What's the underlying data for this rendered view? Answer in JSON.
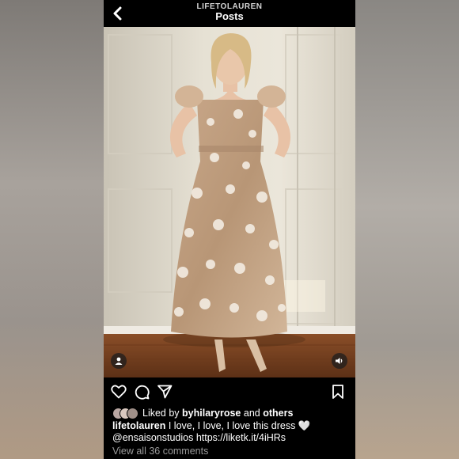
{
  "header": {
    "username": "LIFETOLAUREN",
    "title": "Posts"
  },
  "post": {
    "liked_prefix": "Liked by",
    "liked_user": "byhilaryrose",
    "liked_joiner": "and",
    "liked_others": "others",
    "caption_username": "lifetolauren",
    "caption_text": "I love, I love, I love this dress 🤍",
    "caption_mention": "@ensaisonstudios",
    "caption_link": "https://liketk.it/4iHRs",
    "view_comments": "View all 36 comments"
  },
  "icons": {
    "back": "chevron-left-icon",
    "tag": "person-tag-icon",
    "sound": "speaker-icon",
    "like": "heart-icon",
    "comment": "comment-icon",
    "share": "paper-plane-icon",
    "save": "bookmark-icon"
  },
  "colors": {
    "background": "#000000",
    "text": "#ffffff",
    "muted": "#9a9a9a"
  }
}
